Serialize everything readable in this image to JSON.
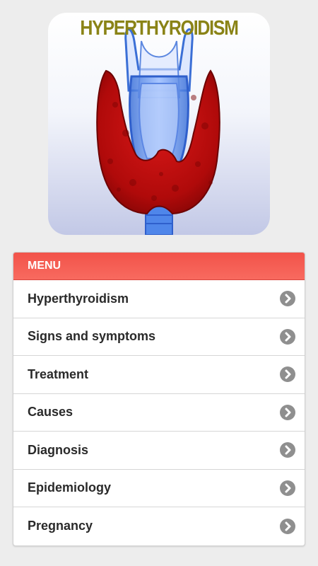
{
  "hero": {
    "title": "HYPERTHYROIDISM",
    "image": "thyroid-gland-illustration"
  },
  "menu": {
    "header": "MENU",
    "items": [
      {
        "label": "Hyperthyroidism",
        "icon": "chevron-right-icon"
      },
      {
        "label": "Signs and symptoms",
        "icon": "chevron-right-icon"
      },
      {
        "label": "Treatment",
        "icon": "chevron-right-icon"
      },
      {
        "label": "Causes",
        "icon": "chevron-right-icon"
      },
      {
        "label": "Diagnosis",
        "icon": "chevron-right-icon"
      },
      {
        "label": "Epidemiology",
        "icon": "chevron-right-icon"
      },
      {
        "label": "Pregnancy",
        "icon": "chevron-right-icon"
      }
    ]
  },
  "colors": {
    "background": "#ededed",
    "header_red": "#f2534a",
    "title_olive": "#8a8316",
    "thyroid_red": "#c80f0f",
    "chevron_gray": "#8f8f8f"
  }
}
